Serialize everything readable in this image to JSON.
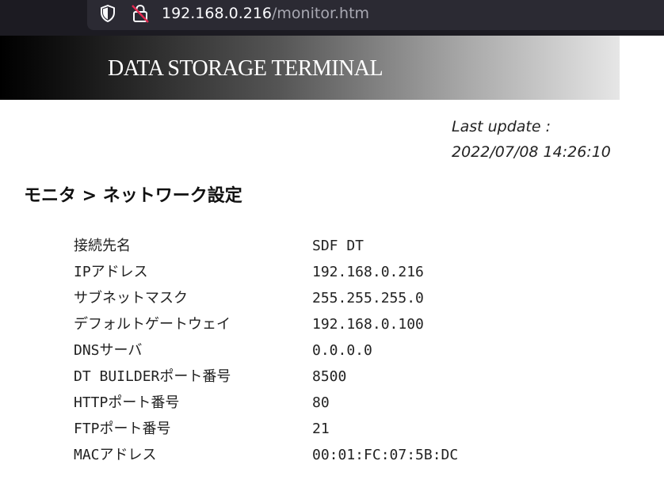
{
  "browser": {
    "url_host": "192.168.0.216",
    "url_path": "/monitor.htm",
    "icons": [
      "shield-icon",
      "lock-icon"
    ]
  },
  "header": {
    "title": "DATA STORAGE TERMINAL"
  },
  "last_update": {
    "label": "Last update :",
    "value": "2022/07/08 14:26:10"
  },
  "breadcrumb": "モニタ > ネットワーク設定",
  "settings": [
    {
      "label": "接続先名",
      "value": "SDF DT"
    },
    {
      "label": "IPアドレス",
      "value": "192.168.0.216"
    },
    {
      "label": "サブネットマスク",
      "value": "255.255.255.0"
    },
    {
      "label": "デフォルトゲートウェイ",
      "value": "192.168.0.100"
    },
    {
      "label": "DNSサーバ",
      "value": "0.0.0.0"
    },
    {
      "label": "DT BUILDERポート番号",
      "value": "8500"
    },
    {
      "label": "HTTPポート番号",
      "value": "80"
    },
    {
      "label": "FTPポート番号",
      "value": "21"
    },
    {
      "label": "MACアドレス",
      "value": "00:01:FC:07:5B:DC"
    }
  ],
  "colors": {
    "browser_bg": "#1c1b22",
    "url_field_bg": "#2b2a33",
    "url_host": "#fbfbfe",
    "url_path": "#a8a8b2",
    "lock_slash": "#e22850"
  }
}
